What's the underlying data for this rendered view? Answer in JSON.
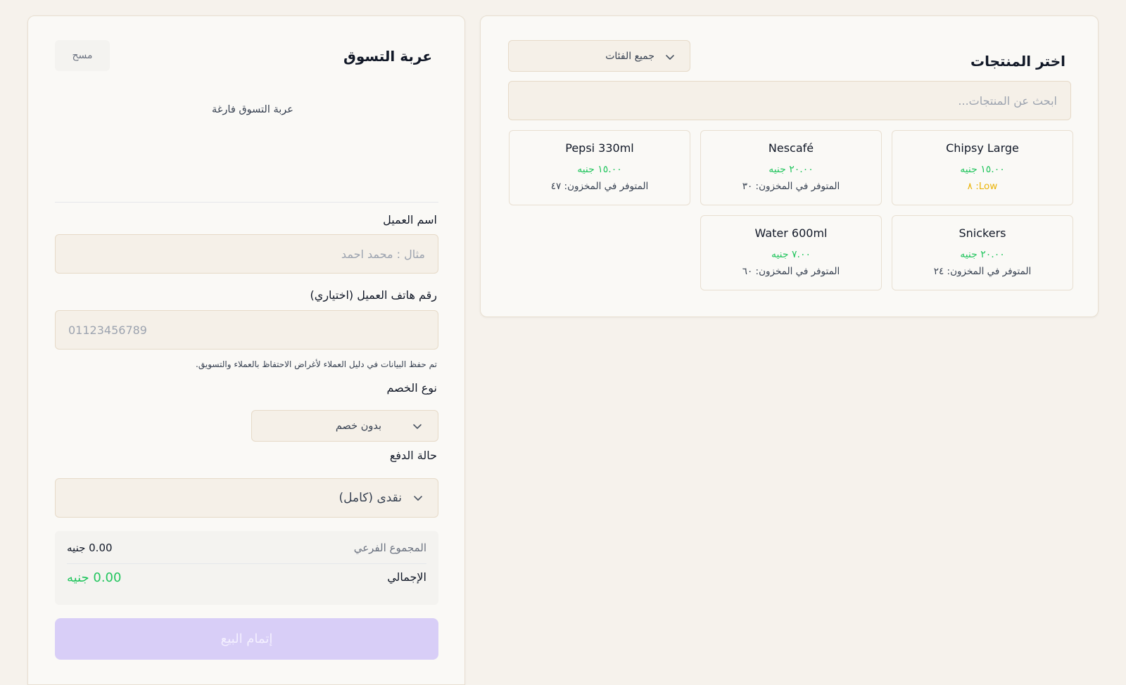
{
  "products": {
    "title": "اختر المنتجات",
    "category_select": {
      "value": "جميع الفئات",
      "icon": "chevron-down-icon"
    },
    "search": {
      "placeholder": "ابحث عن المنتجات..."
    },
    "items": [
      {
        "name": "Chipsy Large",
        "price": "١٥.٠٠ جنيه",
        "stock": "Low: ٨",
        "stock_low": true
      },
      {
        "name": "Nescafé",
        "price": "٢٠.٠٠ جنيه",
        "stock": "المتوفر في المخزون: ٣٠",
        "stock_low": false
      },
      {
        "name": "Pepsi 330ml",
        "price": "١٥.٠٠ جنيه",
        "stock": "المتوفر في المخزون: ٤٧",
        "stock_low": false
      },
      {
        "name": "Snickers",
        "price": "٢٠.٠٠ جنيه",
        "stock": "المتوفر في المخزون: ٢٤",
        "stock_low": false
      },
      {
        "name": "Water 600ml",
        "price": "٧.٠٠ جنيه",
        "stock": "المتوفر في المخزون: ٦٠",
        "stock_low": false
      }
    ]
  },
  "cart": {
    "title": "عربة التسوق",
    "clear_label": "مسح",
    "empty_text": "عربة التسوق فارغة",
    "customer_name": {
      "label": "اسم العميل",
      "placeholder": "مثال : محمد احمد"
    },
    "customer_phone": {
      "label": "رقم هاتف العميل (اختياري)",
      "placeholder": "01123456789"
    },
    "hint": "تم حفظ البيانات في دليل العملاء لأغراض الاحتفاظ بالعملاء والتسويق.",
    "discount": {
      "label": "نوع الخصم",
      "value": "بدون خصم"
    },
    "payment": {
      "label": "حالة الدفع",
      "value": "نقدى (كامل)"
    },
    "subtotal": {
      "label": "المجموع الفرعي",
      "value": "0.00 جنيه"
    },
    "total": {
      "label": "الإجمالي",
      "value": "0.00 جنيه"
    },
    "complete_label": "إتمام البيع"
  },
  "colors": {
    "accent_green": "#22c55e",
    "low_stock": "#eab308",
    "button_disabled": "#d8cef7",
    "background": "#f6f2ec"
  }
}
